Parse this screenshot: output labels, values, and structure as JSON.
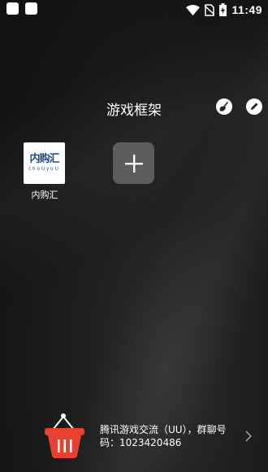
{
  "status_bar": {
    "time": "11:49",
    "icons": [
      "notification-square-icon",
      "notification-square-icon",
      "wifi-icon",
      "no-sim-icon",
      "battery-charging-icon"
    ]
  },
  "header": {
    "title": "游戏框架",
    "actions": [
      "broom-clean-icon",
      "pencil-edit-icon"
    ]
  },
  "apps": [
    {
      "label": "内购汇",
      "logo_text": "内购汇",
      "logo_subtext": "choUyoU"
    }
  ],
  "add_tile": {
    "icon": "plus-icon"
  },
  "banner": {
    "icon": "shopping-basket-icon",
    "text": "腾讯游戏交流（UU），群聊号码：1023420486"
  },
  "colors": {
    "background": "#1a1a1a",
    "add_tile": "#5d5d5d",
    "basket_red": "#e8412f",
    "logo_blue": "#1d4d86"
  }
}
